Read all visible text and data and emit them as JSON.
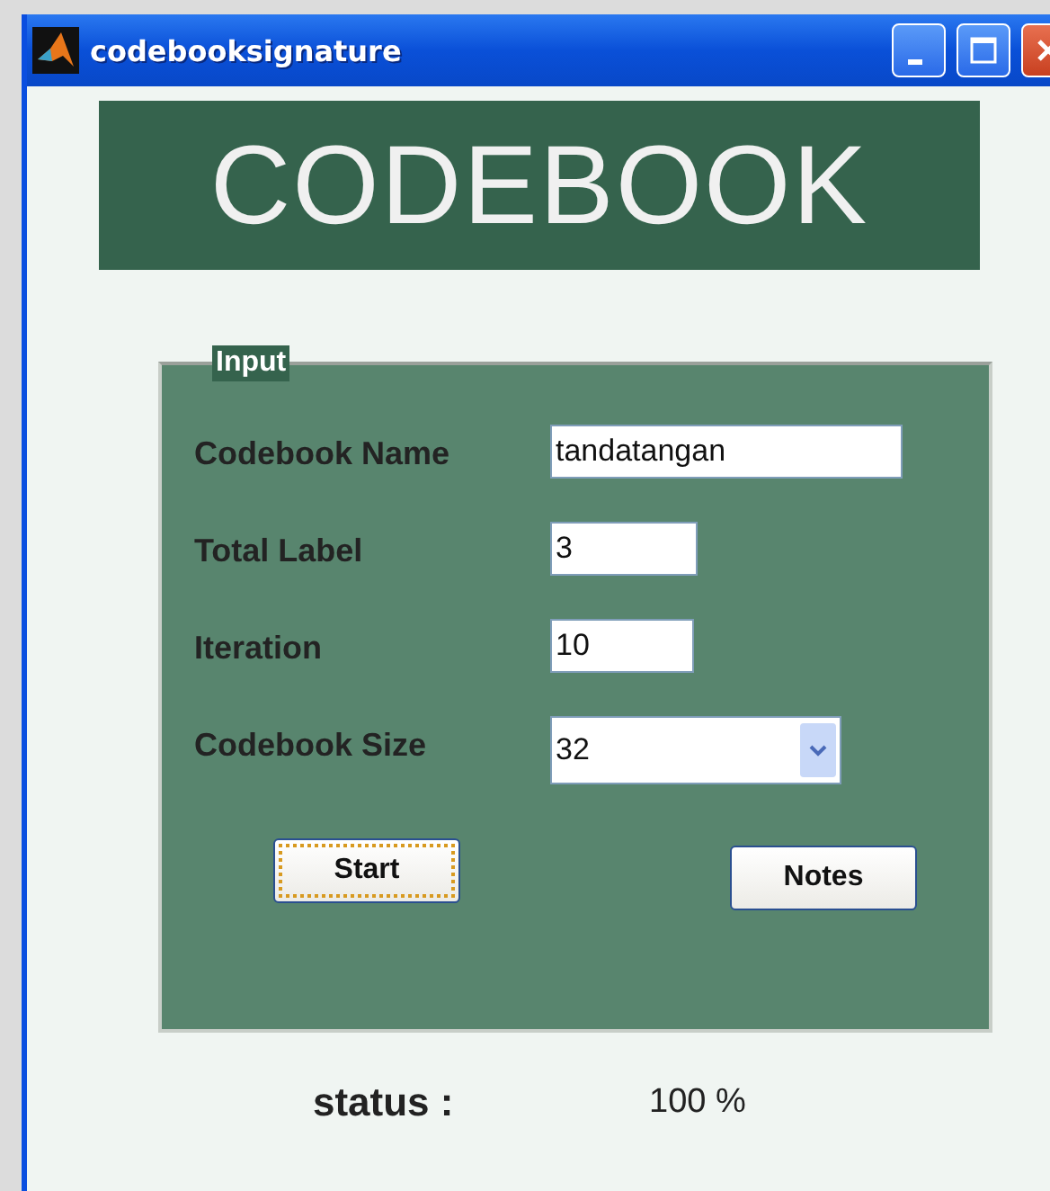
{
  "window": {
    "title": "codebooksignature"
  },
  "banner": {
    "title": "CODEBOOK"
  },
  "input_panel": {
    "title": "Input",
    "fields": [
      {
        "kind": "text",
        "label": "Codebook Name",
        "value": "tandatangan"
      },
      {
        "kind": "text",
        "label": "Total Label",
        "value": "3"
      },
      {
        "kind": "text",
        "label": "Iteration",
        "value": "10"
      },
      {
        "kind": "select",
        "label": "Codebook Size",
        "value": "32"
      }
    ],
    "buttons": [
      {
        "label": "Start",
        "focused": true
      },
      {
        "label": "Notes",
        "focused": false
      }
    ]
  },
  "status": {
    "label": "status :",
    "value": "100 %"
  }
}
